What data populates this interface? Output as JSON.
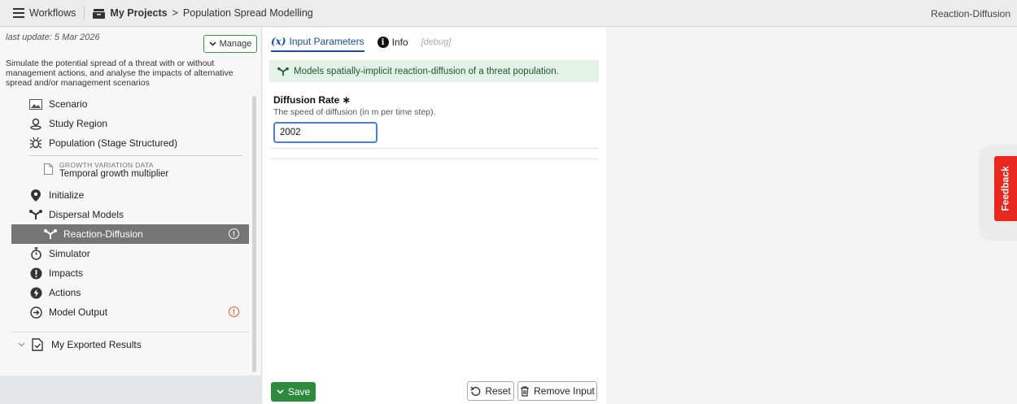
{
  "topbar": {
    "workflows_label": "Workflows",
    "crumb_projects": "My Projects",
    "crumb_sep": ">",
    "crumb_current": "Population Spread Modelling",
    "right_label": "Reaction-Diffusion"
  },
  "sidebar": {
    "last_update": "last update: 5 Mar 2026",
    "manage_label": "Manage",
    "description": "Simulate the potential spread of a threat with or without management actions, and analyse the impacts of alternative spread and/or management scenarios",
    "items": [
      {
        "label": "Scenario",
        "icon": "image-icon"
      },
      {
        "label": "Study Region",
        "icon": "map-pin-icon"
      },
      {
        "label": "Population (Stage Structured)",
        "icon": "bug-icon"
      },
      {
        "label": "Initialize",
        "icon": "location-marker-icon"
      },
      {
        "label": "Dispersal Models",
        "icon": "branch-icon"
      },
      {
        "label": "Reaction-Diffusion",
        "icon": "branch-icon"
      },
      {
        "label": "Simulator",
        "icon": "stopwatch-icon"
      },
      {
        "label": "Impacts",
        "icon": "exclamation-icon"
      },
      {
        "label": "Actions",
        "icon": "bolt-icon"
      },
      {
        "label": "Model Output",
        "icon": "arrow-circle-icon"
      }
    ],
    "growth_caption": "GROWTH VARIATION DATA",
    "growth_title": "Temporal growth multiplier",
    "exported_label": "My Exported Results",
    "alert_glyph": "!"
  },
  "main": {
    "tabs": {
      "input_icon": "(x)",
      "input_label": "Input Parameters",
      "info_icon": "i",
      "info_label": "Info",
      "debug_label": "[debug]"
    },
    "banner": "Models spatially-implicit reaction-diffusion of a threat population.",
    "field": {
      "label": "Diffusion Rate ∗",
      "help": "The speed of diffusion (in m per time step).",
      "value": "2002"
    },
    "buttons": {
      "save": "Save",
      "reset": "Reset",
      "remove": "Remove Input"
    }
  },
  "feedback_label": "Feedback",
  "colors": {
    "accent_green": "#2e8b3e",
    "tab_blue": "#1a4fa0",
    "feedback_red": "#e8281e",
    "warning_orange": "#e05a1e"
  }
}
